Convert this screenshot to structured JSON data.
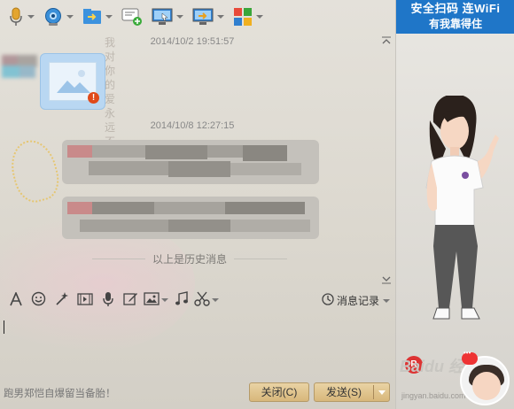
{
  "toolbar": {
    "buttons": [
      {
        "name": "microphone-icon",
        "has_dropdown": true
      },
      {
        "name": "webcam-icon",
        "has_dropdown": true
      },
      {
        "name": "send-file-icon",
        "has_dropdown": true
      },
      {
        "name": "add-chat-icon",
        "has_dropdown": false
      },
      {
        "name": "remote-desktop-icon",
        "has_dropdown": true
      },
      {
        "name": "screen-share-icon",
        "has_dropdown": true
      },
      {
        "name": "apps-icon",
        "has_dropdown": true
      }
    ]
  },
  "messages": {
    "timestamp_1": "2014/10/2 19:51:57",
    "timestamp_2": "2014/10/8 12:27:15",
    "history_label": "以上是历史消息",
    "background_text": "我对你的爱永远不变…"
  },
  "input_toolbar": {
    "tools": [
      "font-icon",
      "emoji-icon",
      "magic-wand-icon",
      "video-clip-icon",
      "voice-icon",
      "edit-icon",
      "image-icon",
      "music-icon",
      "screenshot-icon"
    ],
    "history_label": "消息记录"
  },
  "input": {
    "value": ""
  },
  "footer": {
    "ad_text": "跑男郑恺自爆留当备胎！",
    "close_label": "关闭(C)",
    "send_label": "发送(S)"
  },
  "side": {
    "banner_line1": "安全扫码 连WiFi",
    "banner_line2": "有我靠得住",
    "watermark_logo": "Baidu 经验",
    "watermark_url": "jingyan.baidu.com",
    "badge_text": "R"
  },
  "colors": {
    "banner": "#1f76c8",
    "button": "#d8b77b",
    "image_bubble": "#b9d7f2"
  }
}
